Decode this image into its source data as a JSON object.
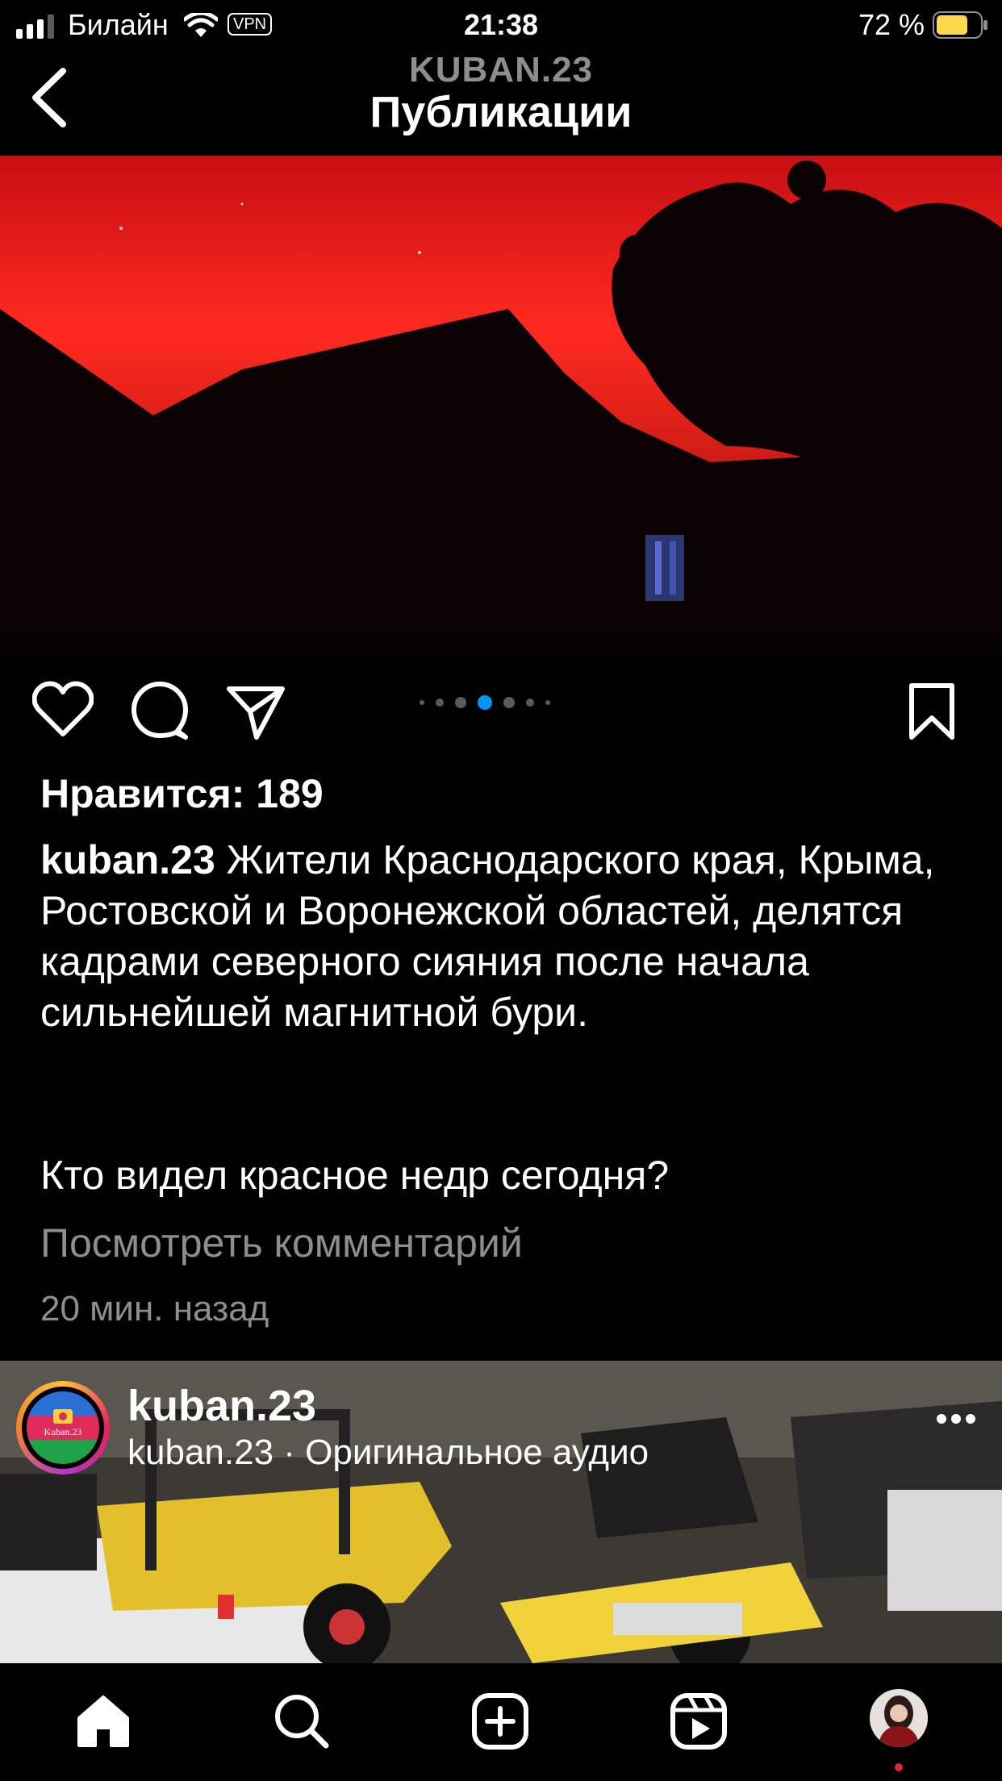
{
  "status_bar": {
    "carrier": "Билайн",
    "vpn": "VPN",
    "time": "21:38",
    "battery": "72 %"
  },
  "header": {
    "username": "KUBAN.23",
    "title": "Публикации"
  },
  "post": {
    "carousel": {
      "total": 7,
      "active": 4
    },
    "likes": "Нравится: 189",
    "caption_user": "kuban.23",
    "caption_text": "Жители Краснодарского края, Крыма, Ростовской и Воронежской областей, делятся кадрами северного сияния после начала сильнейшей магнитной бури.",
    "question": "Кто видел красное недр сегодня?",
    "view_comments": "Посмотреть комментарий",
    "time_ago": "20 мин. назад"
  },
  "next_post": {
    "username": "kuban.23",
    "audio": "kuban.23 · Оригинальное аудио",
    "avatar_text": "Kuban.23"
  },
  "nav": {
    "items": [
      "home-icon",
      "search-icon",
      "create-icon",
      "reels-icon",
      "profile-avatar"
    ],
    "active": "home-icon",
    "notification_color": "#e0243a"
  },
  "colors": {
    "accent_blue": "#0095f6",
    "muted_text": "#8e8e8e",
    "sky_red": "#ff2a20"
  }
}
